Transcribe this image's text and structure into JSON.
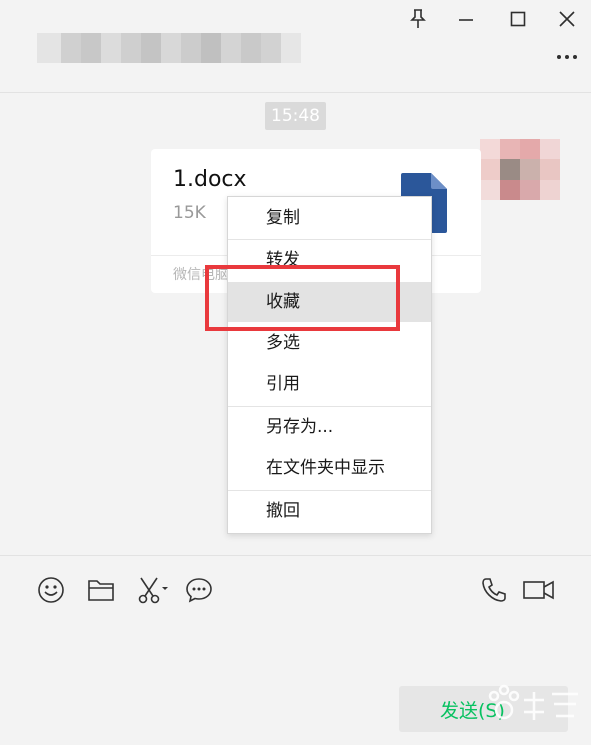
{
  "window": {
    "pin_icon": "pin-icon",
    "minimize_icon": "minimize-icon",
    "maximize_icon": "maximize-icon",
    "close_icon": "close-icon",
    "more_icon": "more-options-icon"
  },
  "chat": {
    "timestamp": "15:48",
    "file_message": {
      "file_name": "1.docx",
      "file_size": "15K",
      "source": "微信电脑",
      "file_icon": "word-document-icon"
    }
  },
  "context_menu": {
    "items": [
      {
        "label": "复制"
      },
      {
        "label": "转发"
      },
      {
        "label": "收藏",
        "highlighted": true
      },
      {
        "label": "多选"
      },
      {
        "label": "引用"
      },
      {
        "label": "另存为..."
      },
      {
        "label": "在文件夹中显示"
      },
      {
        "label": "撤回"
      }
    ]
  },
  "annotation": {
    "color": "#e9393d"
  },
  "toolbar": {
    "emoji_icon": "emoji-icon",
    "folder_icon": "folder-icon",
    "screenshot_icon": "scissors-icon",
    "chat_history_icon": "chat-bubble-icon",
    "voice_call_icon": "phone-icon",
    "video_call_icon": "video-camera-icon"
  },
  "send_button": {
    "label": "发送(S)",
    "color": "#07c160"
  },
  "colors": {
    "background": "#f3f3f3",
    "card": "#ffffff",
    "accent": "#07c160",
    "doc_blue": "#2b579a"
  }
}
